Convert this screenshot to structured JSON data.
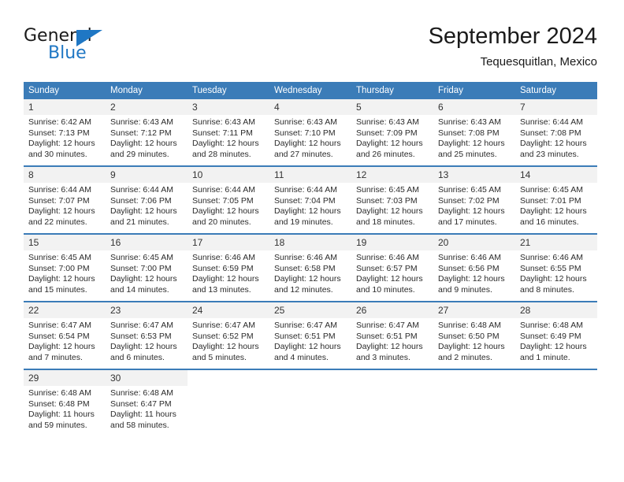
{
  "brand": {
    "name_part1": "General",
    "name_part2": "Blue",
    "accent_color": "#1f77c4"
  },
  "header": {
    "title": "September 2024",
    "subtitle": "Tequesquitlan, Mexico"
  },
  "calendar": {
    "header_color": "#3b7cb8",
    "weekday_headers": [
      "Sunday",
      "Monday",
      "Tuesday",
      "Wednesday",
      "Thursday",
      "Friday",
      "Saturday"
    ],
    "weeks": [
      [
        {
          "day": "1",
          "sunrise": "Sunrise: 6:42 AM",
          "sunset": "Sunset: 7:13 PM",
          "daylight_line1": "Daylight: 12 hours",
          "daylight_line2": "and 30 minutes."
        },
        {
          "day": "2",
          "sunrise": "Sunrise: 6:43 AM",
          "sunset": "Sunset: 7:12 PM",
          "daylight_line1": "Daylight: 12 hours",
          "daylight_line2": "and 29 minutes."
        },
        {
          "day": "3",
          "sunrise": "Sunrise: 6:43 AM",
          "sunset": "Sunset: 7:11 PM",
          "daylight_line1": "Daylight: 12 hours",
          "daylight_line2": "and 28 minutes."
        },
        {
          "day": "4",
          "sunrise": "Sunrise: 6:43 AM",
          "sunset": "Sunset: 7:10 PM",
          "daylight_line1": "Daylight: 12 hours",
          "daylight_line2": "and 27 minutes."
        },
        {
          "day": "5",
          "sunrise": "Sunrise: 6:43 AM",
          "sunset": "Sunset: 7:09 PM",
          "daylight_line1": "Daylight: 12 hours",
          "daylight_line2": "and 26 minutes."
        },
        {
          "day": "6",
          "sunrise": "Sunrise: 6:43 AM",
          "sunset": "Sunset: 7:08 PM",
          "daylight_line1": "Daylight: 12 hours",
          "daylight_line2": "and 25 minutes."
        },
        {
          "day": "7",
          "sunrise": "Sunrise: 6:44 AM",
          "sunset": "Sunset: 7:08 PM",
          "daylight_line1": "Daylight: 12 hours",
          "daylight_line2": "and 23 minutes."
        }
      ],
      [
        {
          "day": "8",
          "sunrise": "Sunrise: 6:44 AM",
          "sunset": "Sunset: 7:07 PM",
          "daylight_line1": "Daylight: 12 hours",
          "daylight_line2": "and 22 minutes."
        },
        {
          "day": "9",
          "sunrise": "Sunrise: 6:44 AM",
          "sunset": "Sunset: 7:06 PM",
          "daylight_line1": "Daylight: 12 hours",
          "daylight_line2": "and 21 minutes."
        },
        {
          "day": "10",
          "sunrise": "Sunrise: 6:44 AM",
          "sunset": "Sunset: 7:05 PM",
          "daylight_line1": "Daylight: 12 hours",
          "daylight_line2": "and 20 minutes."
        },
        {
          "day": "11",
          "sunrise": "Sunrise: 6:44 AM",
          "sunset": "Sunset: 7:04 PM",
          "daylight_line1": "Daylight: 12 hours",
          "daylight_line2": "and 19 minutes."
        },
        {
          "day": "12",
          "sunrise": "Sunrise: 6:45 AM",
          "sunset": "Sunset: 7:03 PM",
          "daylight_line1": "Daylight: 12 hours",
          "daylight_line2": "and 18 minutes."
        },
        {
          "day": "13",
          "sunrise": "Sunrise: 6:45 AM",
          "sunset": "Sunset: 7:02 PM",
          "daylight_line1": "Daylight: 12 hours",
          "daylight_line2": "and 17 minutes."
        },
        {
          "day": "14",
          "sunrise": "Sunrise: 6:45 AM",
          "sunset": "Sunset: 7:01 PM",
          "daylight_line1": "Daylight: 12 hours",
          "daylight_line2": "and 16 minutes."
        }
      ],
      [
        {
          "day": "15",
          "sunrise": "Sunrise: 6:45 AM",
          "sunset": "Sunset: 7:00 PM",
          "daylight_line1": "Daylight: 12 hours",
          "daylight_line2": "and 15 minutes."
        },
        {
          "day": "16",
          "sunrise": "Sunrise: 6:45 AM",
          "sunset": "Sunset: 7:00 PM",
          "daylight_line1": "Daylight: 12 hours",
          "daylight_line2": "and 14 minutes."
        },
        {
          "day": "17",
          "sunrise": "Sunrise: 6:46 AM",
          "sunset": "Sunset: 6:59 PM",
          "daylight_line1": "Daylight: 12 hours",
          "daylight_line2": "and 13 minutes."
        },
        {
          "day": "18",
          "sunrise": "Sunrise: 6:46 AM",
          "sunset": "Sunset: 6:58 PM",
          "daylight_line1": "Daylight: 12 hours",
          "daylight_line2": "and 12 minutes."
        },
        {
          "day": "19",
          "sunrise": "Sunrise: 6:46 AM",
          "sunset": "Sunset: 6:57 PM",
          "daylight_line1": "Daylight: 12 hours",
          "daylight_line2": "and 10 minutes."
        },
        {
          "day": "20",
          "sunrise": "Sunrise: 6:46 AM",
          "sunset": "Sunset: 6:56 PM",
          "daylight_line1": "Daylight: 12 hours",
          "daylight_line2": "and 9 minutes."
        },
        {
          "day": "21",
          "sunrise": "Sunrise: 6:46 AM",
          "sunset": "Sunset: 6:55 PM",
          "daylight_line1": "Daylight: 12 hours",
          "daylight_line2": "and 8 minutes."
        }
      ],
      [
        {
          "day": "22",
          "sunrise": "Sunrise: 6:47 AM",
          "sunset": "Sunset: 6:54 PM",
          "daylight_line1": "Daylight: 12 hours",
          "daylight_line2": "and 7 minutes."
        },
        {
          "day": "23",
          "sunrise": "Sunrise: 6:47 AM",
          "sunset": "Sunset: 6:53 PM",
          "daylight_line1": "Daylight: 12 hours",
          "daylight_line2": "and 6 minutes."
        },
        {
          "day": "24",
          "sunrise": "Sunrise: 6:47 AM",
          "sunset": "Sunset: 6:52 PM",
          "daylight_line1": "Daylight: 12 hours",
          "daylight_line2": "and 5 minutes."
        },
        {
          "day": "25",
          "sunrise": "Sunrise: 6:47 AM",
          "sunset": "Sunset: 6:51 PM",
          "daylight_line1": "Daylight: 12 hours",
          "daylight_line2": "and 4 minutes."
        },
        {
          "day": "26",
          "sunrise": "Sunrise: 6:47 AM",
          "sunset": "Sunset: 6:51 PM",
          "daylight_line1": "Daylight: 12 hours",
          "daylight_line2": "and 3 minutes."
        },
        {
          "day": "27",
          "sunrise": "Sunrise: 6:48 AM",
          "sunset": "Sunset: 6:50 PM",
          "daylight_line1": "Daylight: 12 hours",
          "daylight_line2": "and 2 minutes."
        },
        {
          "day": "28",
          "sunrise": "Sunrise: 6:48 AM",
          "sunset": "Sunset: 6:49 PM",
          "daylight_line1": "Daylight: 12 hours",
          "daylight_line2": "and 1 minute."
        }
      ],
      [
        {
          "day": "29",
          "sunrise": "Sunrise: 6:48 AM",
          "sunset": "Sunset: 6:48 PM",
          "daylight_line1": "Daylight: 11 hours",
          "daylight_line2": "and 59 minutes."
        },
        {
          "day": "30",
          "sunrise": "Sunrise: 6:48 AM",
          "sunset": "Sunset: 6:47 PM",
          "daylight_line1": "Daylight: 11 hours",
          "daylight_line2": "and 58 minutes."
        },
        {
          "day": "",
          "sunrise": "",
          "sunset": "",
          "daylight_line1": "",
          "daylight_line2": ""
        },
        {
          "day": "",
          "sunrise": "",
          "sunset": "",
          "daylight_line1": "",
          "daylight_line2": ""
        },
        {
          "day": "",
          "sunrise": "",
          "sunset": "",
          "daylight_line1": "",
          "daylight_line2": ""
        },
        {
          "day": "",
          "sunrise": "",
          "sunset": "",
          "daylight_line1": "",
          "daylight_line2": ""
        },
        {
          "day": "",
          "sunrise": "",
          "sunset": "",
          "daylight_line1": "",
          "daylight_line2": ""
        }
      ]
    ]
  }
}
